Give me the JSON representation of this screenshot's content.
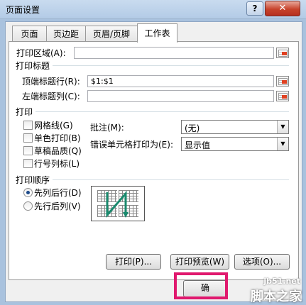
{
  "window": {
    "title": "页面设置",
    "help": "?",
    "close": "✕"
  },
  "tabs": [
    {
      "label": "页面",
      "active": false
    },
    {
      "label": "页边距",
      "active": false
    },
    {
      "label": "页眉/页脚",
      "active": false
    },
    {
      "label": "工作表",
      "active": true
    }
  ],
  "print_area": {
    "label": "打印区域(A):",
    "value": ""
  },
  "print_titles": {
    "heading": "打印标题",
    "rows_label": "顶端标题行(R):",
    "rows_value": "$1:$1",
    "cols_label": "左端标题列(C):",
    "cols_value": ""
  },
  "print": {
    "heading": "打印",
    "checkboxes": [
      {
        "label": "网格线(G)",
        "checked": false
      },
      {
        "label": "单色打印(B)",
        "checked": false
      },
      {
        "label": "草稿品质(Q)",
        "checked": false
      },
      {
        "label": "行号列标(L)",
        "checked": false
      }
    ],
    "comments_label": "批注(M):",
    "comments_value": "(无)",
    "errors_label": "错误单元格打印为(E):",
    "errors_value": "显示值"
  },
  "page_order": {
    "heading": "打印顺序",
    "options": [
      {
        "label": "先列后行(D)",
        "selected": true
      },
      {
        "label": "先行后列(V)",
        "selected": false
      }
    ]
  },
  "buttons": {
    "print": "打印(P)...",
    "preview": "打印预览(W)",
    "options": "选项(O)...",
    "ok": "确"
  },
  "watermark": {
    "site": "jb51.net",
    "brand": "脚本之家"
  },
  "colors": {
    "highlight": "#e0196e",
    "arrow": "#1a8a6e"
  }
}
